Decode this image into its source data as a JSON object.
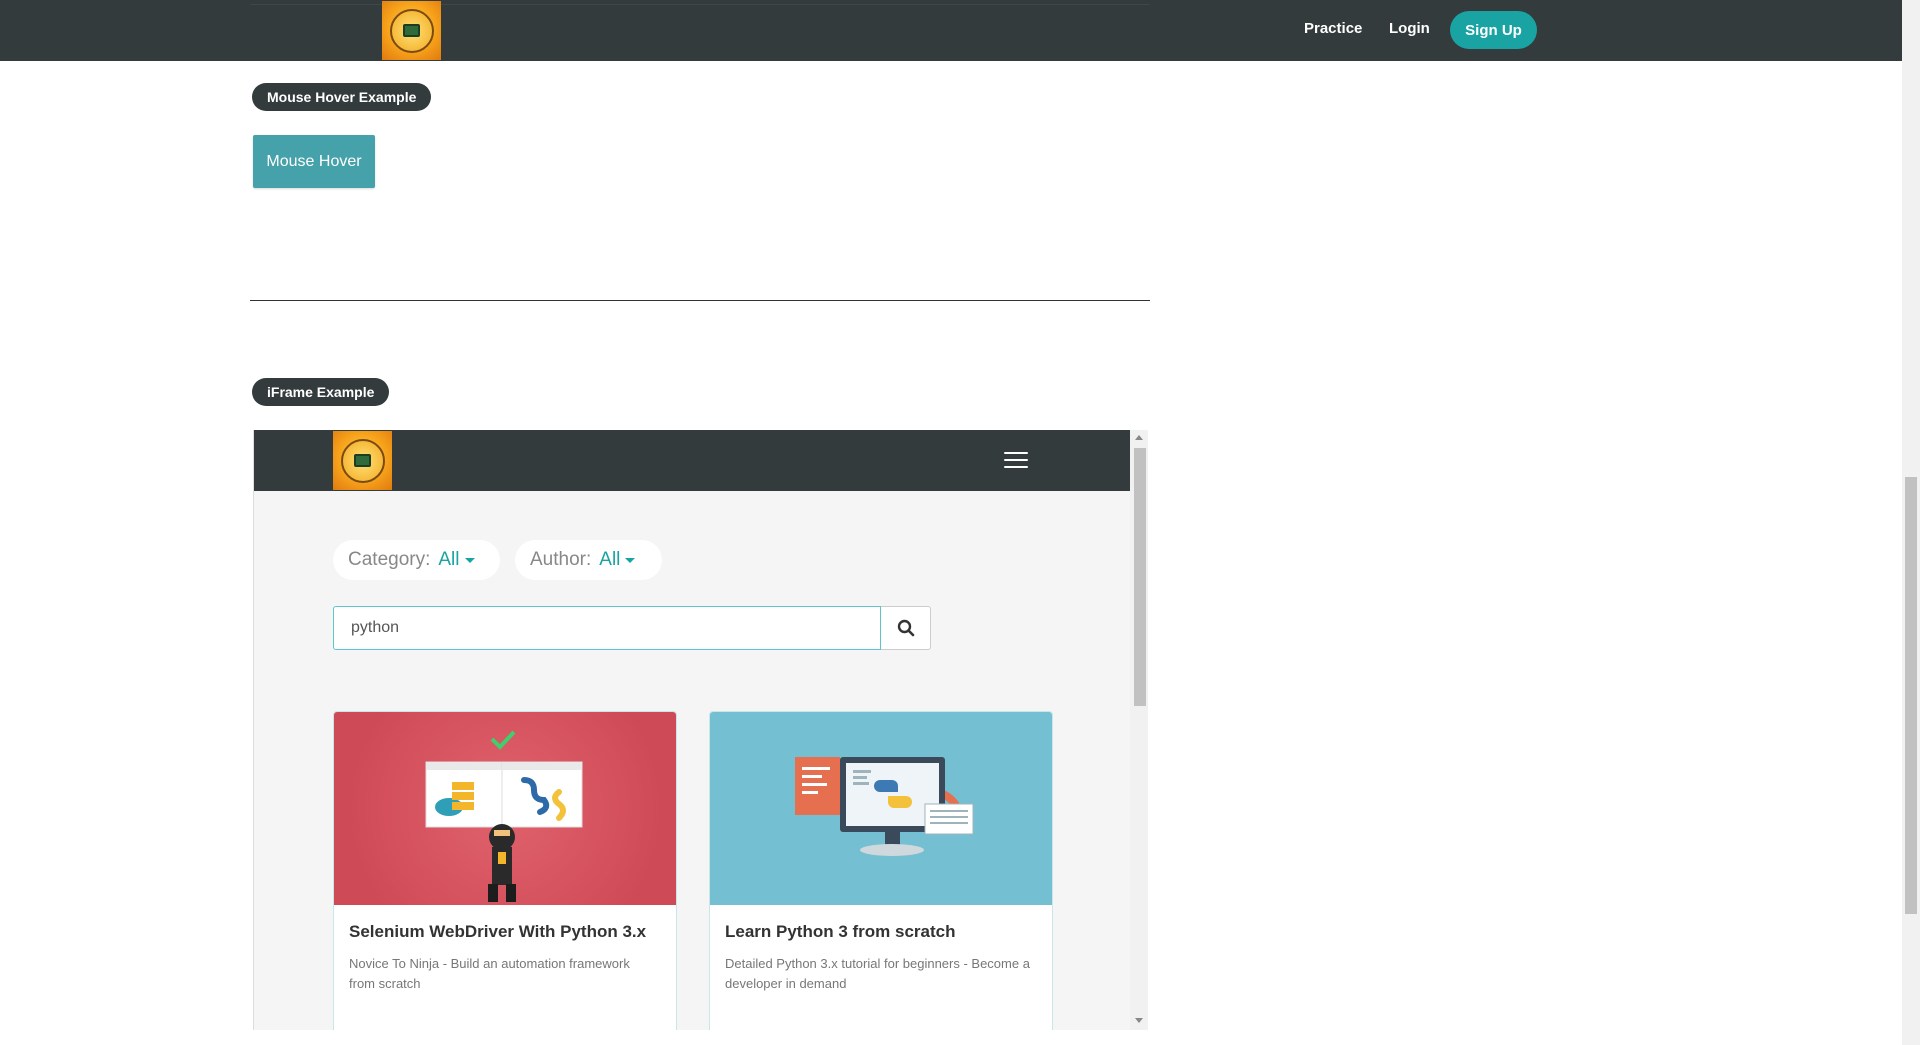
{
  "header": {
    "nav_links": [
      "Practice",
      "Login"
    ],
    "signup_label": "Sign Up"
  },
  "mouse_hover": {
    "section_label": "Mouse Hover Example",
    "button_label": "Mouse Hover"
  },
  "iframe_section": {
    "section_label": "iFrame Example",
    "filters": [
      {
        "label": "Category:",
        "value": "All"
      },
      {
        "label": "Author:",
        "value": "All"
      }
    ],
    "search": {
      "value": "python"
    },
    "courses": [
      {
        "title": "Selenium WebDriver With Python 3.x",
        "description": "Novice To Ninja - Build an automation framework from scratch"
      },
      {
        "title": "Learn Python 3 from scratch",
        "description": "Detailed Python 3.x tutorial for beginners - Become a developer in demand"
      }
    ]
  },
  "colors": {
    "nav_bg": "#333b3d",
    "accent": "#1aa3a3",
    "hover_button": "#45a1aa",
    "card1_bg": "#d4505e",
    "card2_bg": "#74c0d2"
  },
  "icons": [
    "logo-icon",
    "hamburger-menu-icon",
    "search-icon",
    "caret-down-icon",
    "checkmark-icon"
  ]
}
